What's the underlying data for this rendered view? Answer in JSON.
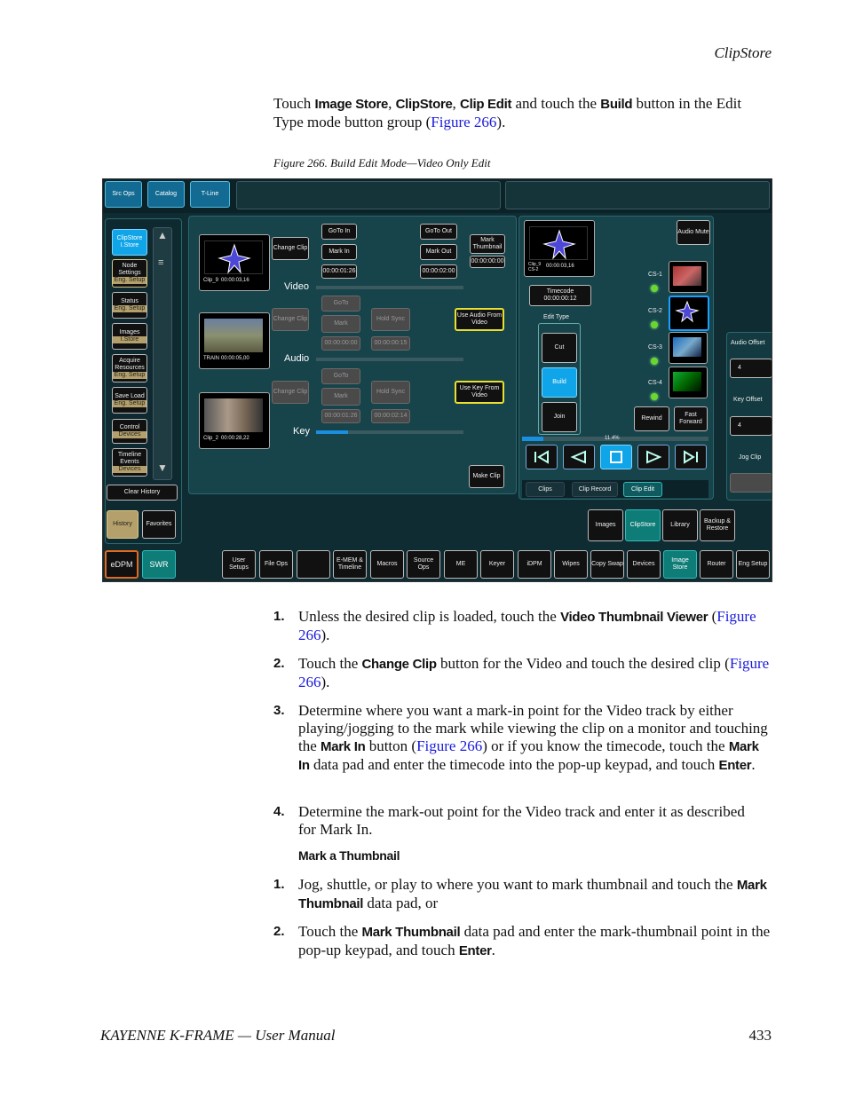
{
  "header": {
    "section": "ClipStore"
  },
  "intro": {
    "pre": "Touch ",
    "ui1": "Image Store",
    "c1": ", ",
    "ui2": "ClipStore",
    "c2": ", ",
    "ui3": "Clip Edit",
    "mid": " and touch the ",
    "ui4": "Build",
    "post": " button in the Edit Type mode button group (",
    "link": "Figure 266",
    "end": ")."
  },
  "figure_caption": "Figure 266.  Build Edit Mode—Video Only Edit",
  "screenshot": {
    "top_tabs": [
      "Src Ops",
      "Catalog",
      "T-Line"
    ],
    "left_menu": [
      {
        "label": "ClipStore",
        "sub": "I.Store"
      },
      {
        "label": "Node Settings",
        "sub": "Eng. Setup"
      },
      {
        "label": "Status",
        "sub": "Eng. Setup"
      },
      {
        "label": "Images",
        "sub": "I.Store"
      },
      {
        "label": "Acquire Resources",
        "sub": "Eng. Setup"
      },
      {
        "label": "Save Load",
        "sub": "Eng. Setup"
      },
      {
        "label": "Control",
        "sub": "Devices"
      },
      {
        "label": "Timeline Events",
        "sub": "Devices"
      }
    ],
    "clear_history": "Clear History",
    "history": "History",
    "favorites": "Favorites",
    "edpm": "eDPM",
    "swr": "SWR",
    "video": {
      "label": "Video",
      "clip": "Clip_9",
      "tc": "00:00:03,16",
      "change": "Change Clip",
      "goto_in": "GoTo In",
      "mark_in": "Mark In",
      "in_tc": "00:00:01:26",
      "goto_out": "GoTo Out",
      "mark_out": "Mark Out",
      "out_tc": "00:00:02:00",
      "mark_thumb": "Mark Thumbnail",
      "thumb_tc": "00:00:00:00"
    },
    "audio": {
      "label": "Audio",
      "clip": "TRAIN",
      "tc": "00:00:05,00",
      "change": "Change Clip",
      "goto": "GoTo",
      "mark": "Mark",
      "in_tc": "00:00:00:00",
      "hold": "Hold Sync",
      "out_tc": "00:00:00:15",
      "use": "Use Audio From Video"
    },
    "key": {
      "label": "Key",
      "clip": "Clip_2",
      "tc": "00:00:28,22",
      "change": "Change Clip",
      "goto": "GoTo",
      "mark": "Mark",
      "in_tc": "00:00:01:26",
      "hold": "Hold Sync",
      "out_tc": "00:00:02:14",
      "use": "Use Key From Video"
    },
    "make_clip": "Make Clip",
    "preview": {
      "clip": "Clip_9 CS-2",
      "tc": "00:00:03,16",
      "timecode_label": "Timecode",
      "timecode": "00:00:00:12",
      "edit_type": "Edit Type"
    },
    "edit_types": [
      "Cut",
      "Build",
      "Join"
    ],
    "audio_mute": "Audio Mute",
    "cs": [
      "CS-1",
      "CS-2",
      "CS-3",
      "CS-4"
    ],
    "rewind": "Rewind",
    "fast_forward": "Fast Forward",
    "progress": {
      "label": "11.4%",
      "value": 0.114
    },
    "audio_offset": {
      "label": "Audio Offset",
      "value": "4"
    },
    "key_offset": {
      "label": "Key Offset",
      "value": "4"
    },
    "jog_clip": "Jog Clip",
    "clip_tabs": [
      "Clips",
      "Clip Record",
      "Clip Edit"
    ],
    "app_tabs": [
      "Images",
      "ClipStore",
      "Library",
      "Backup & Restore"
    ],
    "bottom_menu": [
      "User Setups",
      "File Ops",
      "",
      "E-MEM & Timeline",
      "Macros",
      "Source Ops",
      "ME",
      "Keyer",
      "iDPM",
      "Wipes",
      "Copy Swap",
      "Devices",
      "Image Store",
      "Router",
      "Eng Setup"
    ]
  },
  "steps": [
    {
      "n": "1.",
      "parts": [
        "Unless the desired clip is loaded, touch the ",
        "Video Thumbnail Viewer",
        " (",
        "Figure 266",
        ")."
      ]
    },
    {
      "n": "2.",
      "parts": [
        "Touch the ",
        "Change Clip",
        " button for the Video and touch the desired clip (",
        "Figure 266",
        ")."
      ]
    },
    {
      "n": "3.",
      "a": "Determine where you want a mark-in point for the Video track by either playing/jogging to the mark while viewing the clip on a monitor and touching the ",
      "b": "Mark In",
      "c": " button (",
      "link": "Figure 266",
      "d": ") or if you know the timecode, touch the ",
      "e": "Mark In",
      "f": " data pad and enter the timecode into the pop-up keypad, and touch ",
      "g": "Enter",
      "h": "."
    },
    {
      "n": "4.",
      "text": "Determine the mark-out point for the Video track and enter it as described for Mark In."
    }
  ],
  "subheading": "Mark a Thumbnail",
  "steps2": [
    {
      "n": "1.",
      "a": "Jog, shuttle, or play to where you want to mark thumbnail and touch the ",
      "b": "Mark Thumbnail",
      "c": " data pad, or"
    },
    {
      "n": "2.",
      "a": "Touch the ",
      "b": "Mark Thumbnail",
      "c": " data pad and enter the mark-thumbnail point in the pop-up keypad, and touch ",
      "d": "Enter",
      "e": "."
    }
  ],
  "footer": {
    "manual": "KAYENNE K-FRAME  —  User Manual",
    "page": "433"
  }
}
